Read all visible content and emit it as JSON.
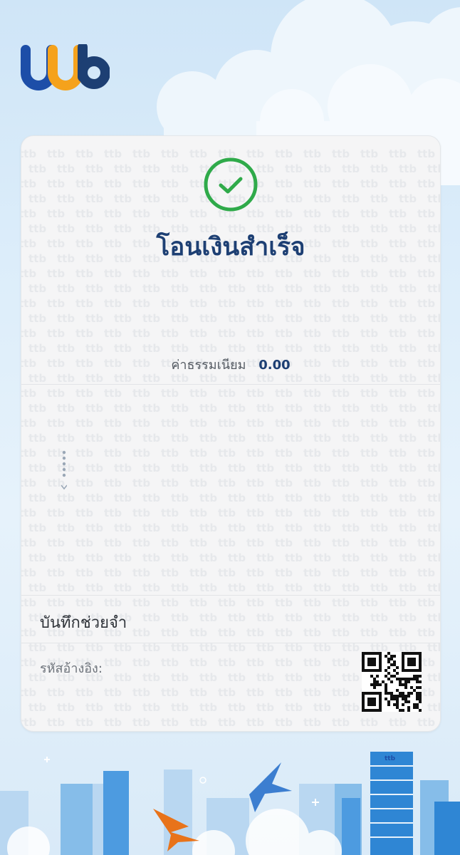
{
  "brand": {
    "logo_text": "ttb"
  },
  "status": {
    "icon": "check-circle-icon",
    "title": "โอนเงินสำเร็จ",
    "color": "#2faa4a"
  },
  "fee": {
    "label": "ค่าธรรมเนียม",
    "value": "0.00"
  },
  "memo": {
    "label": "บันทึกช่วยจำ"
  },
  "reference": {
    "label": "รหัสอ้างอิง:",
    "qr_icon": "qr-code-icon"
  },
  "colors": {
    "brand_blue": "#1d3f73",
    "brand_orange": "#f5a21c",
    "logo_blue": "#1d4ea8",
    "success_green": "#2faa4a"
  }
}
